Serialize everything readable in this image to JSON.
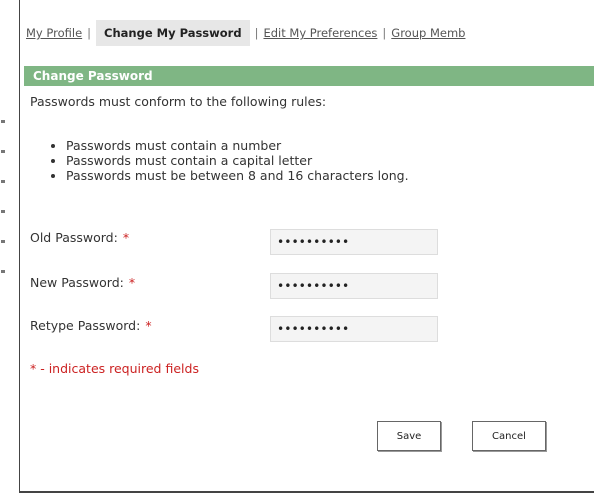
{
  "tabs": {
    "my_profile": "My Profile",
    "change_password": "Change My Password",
    "edit_preferences": "Edit My Preferences",
    "group_membership": "Group Memb",
    "separator": "|"
  },
  "section": {
    "title": "Change Password"
  },
  "rules": {
    "intro": "Passwords must conform to the following rules:",
    "items": [
      "Passwords must contain a number",
      "Passwords must contain a capital letter",
      "Passwords must be between 8 and 16 characters long."
    ]
  },
  "form": {
    "old_password": {
      "label": "Old Password:",
      "value": "••••••••••"
    },
    "new_password": {
      "label": "New Password:",
      "value": "••••••••••"
    },
    "retype_password": {
      "label": "Retype Password:",
      "value": "••••••••••"
    },
    "required_marker": "*",
    "required_note": "* - indicates required fields"
  },
  "buttons": {
    "save": "Save",
    "cancel": "Cancel"
  },
  "colors": {
    "header_green": "#7fb684",
    "required_red": "#cc2222",
    "active_tab_bg": "#e7e7e7"
  }
}
